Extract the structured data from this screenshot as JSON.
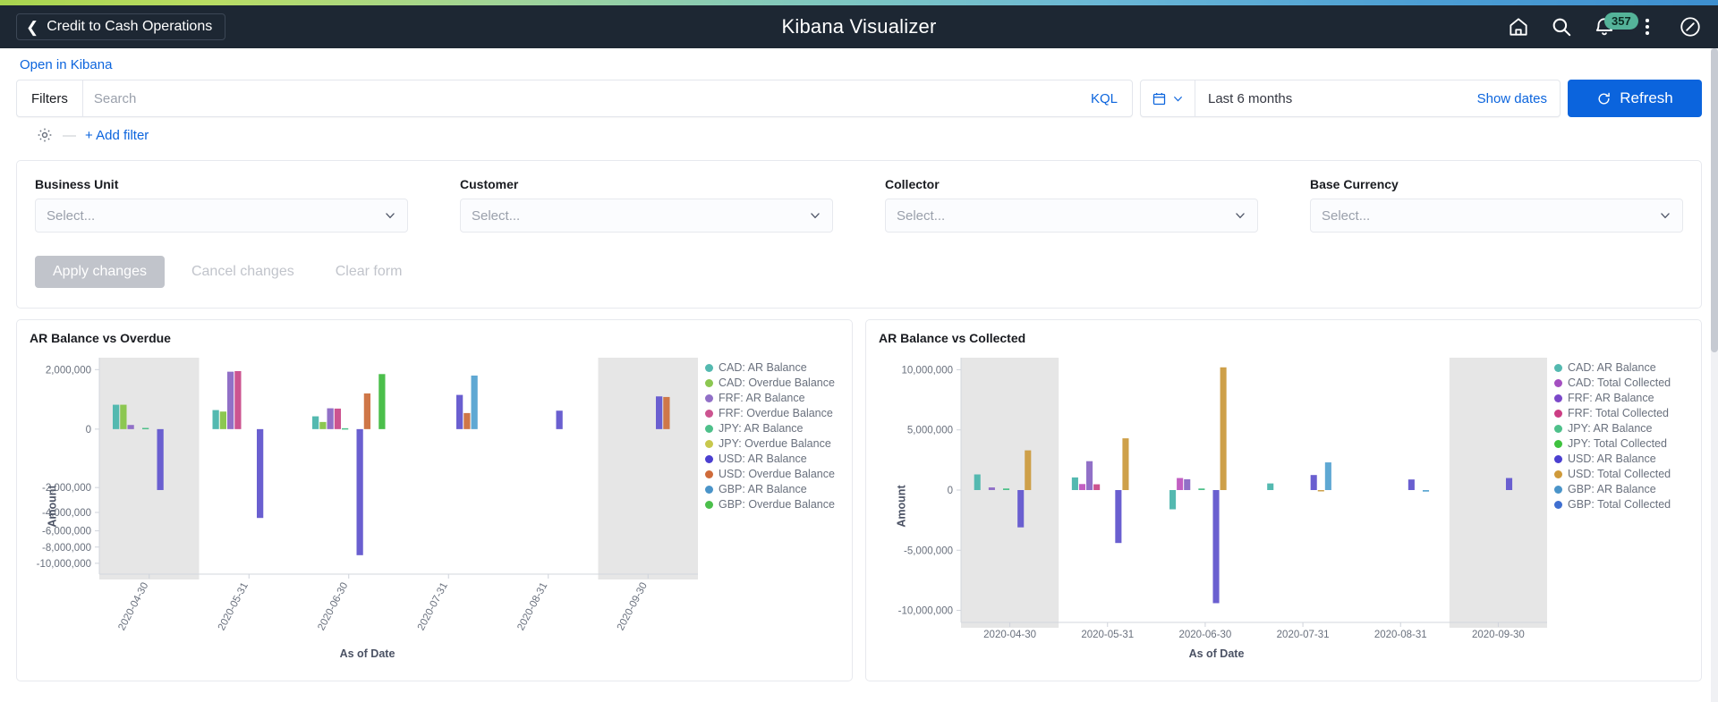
{
  "header": {
    "back_label": "Credit to Cash Operations",
    "back_icon": "chevron-left-icon",
    "title": "Kibana Visualizer",
    "actions": [
      {
        "name": "home-icon",
        "label": "Home"
      },
      {
        "name": "search-icon",
        "label": "Search"
      },
      {
        "name": "bell-icon",
        "label": "Notifications",
        "badge": "357"
      },
      {
        "name": "more-vertical-icon",
        "label": "More"
      },
      {
        "name": "compass-icon",
        "label": "Navigator"
      }
    ]
  },
  "open_in_kibana": "Open in Kibana",
  "query_bar": {
    "filters_label": "Filters",
    "search_placeholder": "Search",
    "search_value": "",
    "kql_label": "KQL",
    "calendar_icon": "calendar-icon",
    "date_range": "Last 6 months",
    "show_dates_label": "Show dates",
    "refresh_label": "Refresh",
    "refresh_icon": "refresh-icon"
  },
  "filter_row": {
    "gear_icon": "gear-icon",
    "dash": "—",
    "add_filter_label": "+ Add filter"
  },
  "filter_form": {
    "fields": [
      {
        "label": "Business Unit",
        "value": "Select...",
        "icon": "chevron-down-icon"
      },
      {
        "label": "Customer",
        "value": "Select...",
        "icon": "chevron-down-icon"
      },
      {
        "label": "Collector",
        "value": "Select...",
        "icon": "chevron-down-icon"
      },
      {
        "label": "Base Currency",
        "value": "Select...",
        "icon": "chevron-down-icon"
      }
    ],
    "apply_label": "Apply changes",
    "cancel_label": "Cancel changes",
    "clear_label": "Clear form"
  },
  "colors": {
    "accent_blue": "#0b64dd",
    "header_bg": "#1d2733",
    "badge_green": "#54b399",
    "teal": "#54b9b0",
    "yellow_green": "#8cc751",
    "purple": "#9170c7",
    "magenta": "#cc5490",
    "green": "#4ec08a",
    "olive": "#c8c84d",
    "indigo": "#6a5fd0",
    "orange": "#cf7748",
    "blue": "#5fa8d3",
    "bright_green": "#4bbf4b",
    "gold": "#ceA049",
    "orchid": "#c25fc2"
  },
  "chart_data": [
    {
      "type": "bar",
      "title": "AR Balance vs Overdue",
      "xlabel": "As of Date",
      "ylabel": "Amount",
      "categories": [
        "2020-04-30",
        "2020-05-31",
        "2020-06-30",
        "2020-07-31",
        "2020-08-31",
        "2020-09-30"
      ],
      "yticks": [
        2000000,
        0,
        -2000000,
        -4000000,
        -6000000,
        -8000000,
        -10000000
      ],
      "yticklabels": [
        "2,000,000",
        "0",
        "-2,000,000",
        "-4,000,000",
        "-6,000,000",
        "-8,000,000",
        "-10,000,000"
      ],
      "ylim": [
        -10000000,
        2600000
      ],
      "scale": "nonlinear",
      "legend_position": "right",
      "grid": false,
      "legend": [
        {
          "label": "CAD: AR Balance",
          "color": "#54b9b0"
        },
        {
          "label": "CAD: Overdue Balance",
          "color": "#8cc751"
        },
        {
          "label": "FRF: AR Balance",
          "color": "#9170c7"
        },
        {
          "label": "FRF: Overdue Balance",
          "color": "#cc5490"
        },
        {
          "label": "JPY: AR Balance",
          "color": "#4ec08a"
        },
        {
          "label": "JPY: Overdue Balance",
          "color": "#c8c84d"
        },
        {
          "label": "USD: AR Balance",
          "color": "#4b3fd0"
        },
        {
          "label": "USD: Overdue Balance",
          "color": "#cf6b3a"
        },
        {
          "label": "GBP: AR Balance",
          "color": "#4a94c9"
        },
        {
          "label": "GBP: Overdue Balance",
          "color": "#4bbf4b"
        }
      ],
      "series": [
        {
          "name": "CAD: AR Balance",
          "color": "#54b9b0",
          "values": [
            820000,
            640000,
            430000,
            null,
            null,
            null
          ]
        },
        {
          "name": "CAD: Overdue Balance",
          "color": "#8cc751",
          "values": [
            820000,
            590000,
            240000,
            null,
            null,
            null
          ]
        },
        {
          "name": "FRF: AR Balance",
          "color": "#9170c7",
          "values": [
            140000,
            1930000,
            700000,
            null,
            null,
            null
          ]
        },
        {
          "name": "FRF: Overdue Balance",
          "color": "#cc5490",
          "values": [
            null,
            1950000,
            690000,
            null,
            null,
            null
          ]
        },
        {
          "name": "JPY: AR Balance",
          "color": "#4ec08a",
          "values": [
            40000,
            null,
            30000,
            null,
            null,
            null
          ]
        },
        {
          "name": "JPY: Overdue Balance",
          "color": "#c8c84d",
          "values": [
            null,
            null,
            null,
            null,
            null,
            null
          ]
        },
        {
          "name": "USD: AR Balance",
          "color": "#6a5fd0",
          "values": [
            -2200000,
            -4600000,
            -9000000,
            1150000,
            620000,
            1100000
          ]
        },
        {
          "name": "USD: Overdue Balance",
          "color": "#cf7748",
          "values": [
            null,
            null,
            1200000,
            540000,
            null,
            1080000
          ]
        },
        {
          "name": "GBP: AR Balance",
          "color": "#5fa8d3",
          "values": [
            null,
            null,
            null,
            1800000,
            null,
            null
          ]
        },
        {
          "name": "GBP: Overdue Balance",
          "color": "#4bbf4b",
          "values": [
            null,
            null,
            1850000,
            null,
            null,
            null
          ]
        }
      ]
    },
    {
      "type": "bar",
      "title": "AR Balance vs Collected",
      "xlabel": "As of Date",
      "ylabel": "Amount",
      "categories": [
        "2020-04-30",
        "2020-05-31",
        "2020-06-30",
        "2020-07-31",
        "2020-08-31",
        "2020-09-30"
      ],
      "yticks": [
        10000000,
        5000000,
        0,
        -5000000,
        -10000000
      ],
      "yticklabels": [
        "10,000,000",
        "5,000,000",
        "0",
        "-5,000,000",
        "-10,000,000"
      ],
      "ylim": [
        -11000000,
        11000000
      ],
      "scale": "linear",
      "legend_position": "right",
      "grid": false,
      "legend": [
        {
          "label": "CAD: AR Balance",
          "color": "#54b9b0"
        },
        {
          "label": "CAD: Total Collected",
          "color": "#a44fc0"
        },
        {
          "label": "FRF: AR Balance",
          "color": "#7b48c9"
        },
        {
          "label": "FRF: Total Collected",
          "color": "#cc3d84"
        },
        {
          "label": "JPY: AR Balance",
          "color": "#4ec08a"
        },
        {
          "label": "JPY: Total Collected",
          "color": "#3ec23e"
        },
        {
          "label": "USD: AR Balance",
          "color": "#4b3fd0"
        },
        {
          "label": "USD: Total Collected",
          "color": "#cf9a3a"
        },
        {
          "label": "GBP: AR Balance",
          "color": "#4a94c9"
        },
        {
          "label": "GBP: Total Collected",
          "color": "#3f6fd0"
        }
      ],
      "series": [
        {
          "name": "CAD: AR Balance",
          "color": "#54b9b0",
          "values": [
            1300000,
            1050000,
            -1600000,
            550000,
            null,
            null
          ]
        },
        {
          "name": "CAD: Total Collected",
          "color": "#c25fc2",
          "values": [
            null,
            500000,
            1000000,
            null,
            null,
            null
          ]
        },
        {
          "name": "FRF: AR Balance",
          "color": "#9170c7",
          "values": [
            220000,
            2400000,
            900000,
            null,
            null,
            null
          ]
        },
        {
          "name": "FRF: Total Collected",
          "color": "#cc5490",
          "values": [
            null,
            480000,
            null,
            null,
            null,
            null
          ]
        },
        {
          "name": "JPY: AR Balance",
          "color": "#4ec08a",
          "values": [
            130000,
            null,
            130000,
            null,
            null,
            null
          ]
        },
        {
          "name": "JPY: Total Collected",
          "color": "#3ec23e",
          "values": [
            null,
            null,
            null,
            null,
            null,
            null
          ]
        },
        {
          "name": "USD: AR Balance",
          "color": "#6a5fd0",
          "values": [
            -3100000,
            -4400000,
            -9400000,
            1250000,
            880000,
            1000000
          ]
        },
        {
          "name": "USD: Total Collected",
          "color": "#cea049",
          "values": [
            3300000,
            4300000,
            10200000,
            -80000,
            null,
            null
          ]
        },
        {
          "name": "GBP: AR Balance",
          "color": "#5fa8d3",
          "values": [
            null,
            null,
            null,
            2300000,
            -130000,
            null
          ]
        },
        {
          "name": "GBP: Total Collected",
          "color": "#3f6fd0",
          "values": [
            null,
            null,
            null,
            null,
            null,
            null
          ]
        }
      ]
    }
  ]
}
